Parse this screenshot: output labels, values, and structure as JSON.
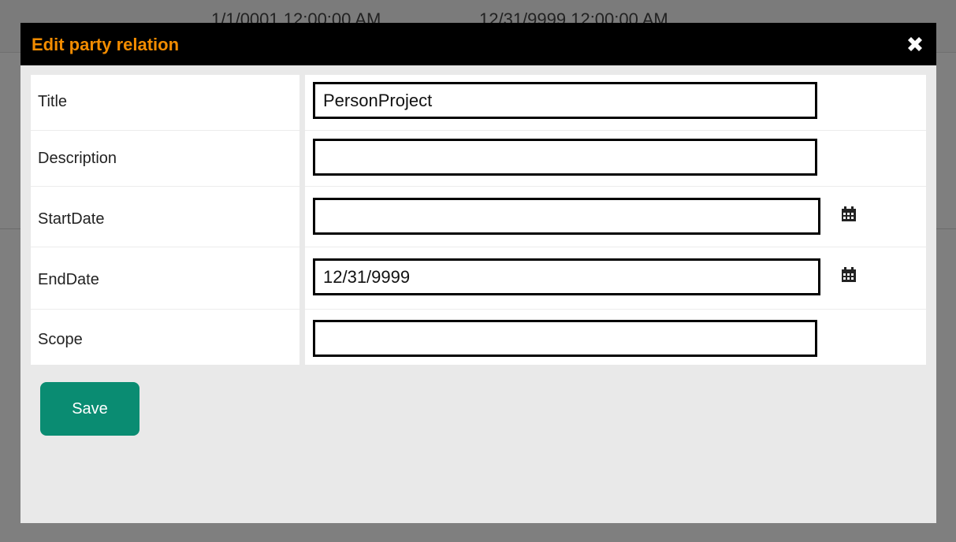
{
  "background": {
    "row_start": "1/1/0001 12:00:00 AM",
    "row_end": "12/31/9999 12:00:00 AM"
  },
  "dialog": {
    "title": "Edit party relation",
    "close_icon": "close-icon",
    "fields": {
      "title": {
        "label": "Title",
        "value": "PersonProject"
      },
      "description": {
        "label": "Description",
        "value": ""
      },
      "start_date": {
        "label": "StartDate",
        "value": ""
      },
      "end_date": {
        "label": "EndDate",
        "value": "12/31/9999"
      },
      "scope": {
        "label": "Scope",
        "value": ""
      }
    },
    "calendar_icon": "calendar-icon",
    "save_label": "Save"
  },
  "colors": {
    "title_bar": "#000000",
    "title_text": "#f28c00",
    "save_button": "#0a8c72",
    "overlay_background": "#7f7f7f",
    "dialog_background": "#e9e9e9"
  }
}
